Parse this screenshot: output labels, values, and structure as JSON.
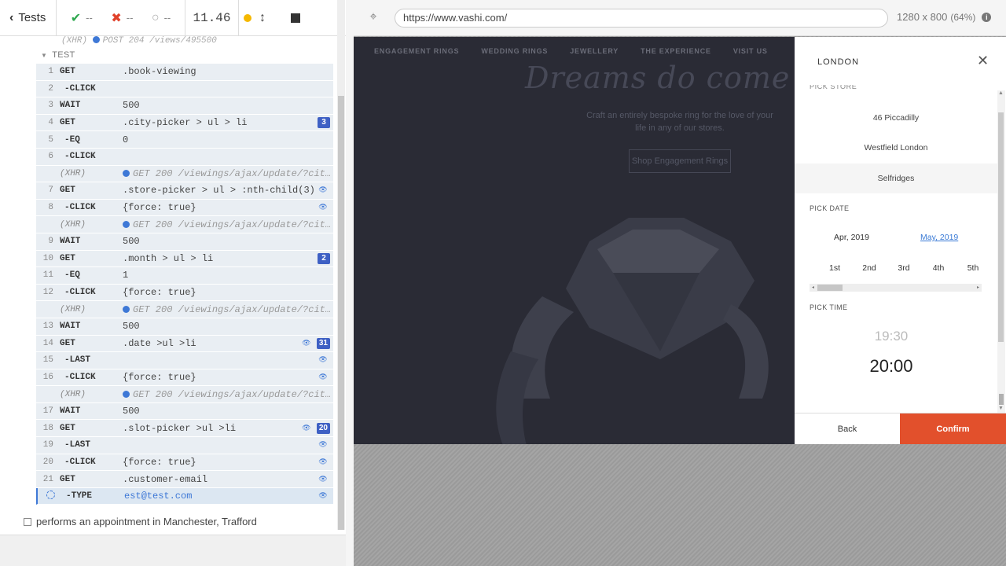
{
  "header": {
    "tests_label": "Tests",
    "passed": "--",
    "failed": "--",
    "pending": "--",
    "duration": "11.46"
  },
  "reporter": {
    "prev_command": "POST 204 /views/495500",
    "suite_label": "TEST",
    "commands": [
      {
        "num": "1",
        "name": "GET",
        "msg": ".book-viewing",
        "type": "cmd"
      },
      {
        "num": "2",
        "name": "-CLICK",
        "msg": "",
        "type": "child"
      },
      {
        "num": "3",
        "name": "WAIT",
        "msg": "500",
        "type": "cmd"
      },
      {
        "num": "4",
        "name": "GET",
        "msg": ".city-picker > ul > li",
        "type": "cmd",
        "badge": "3"
      },
      {
        "num": "5",
        "name": "-EQ",
        "msg": "0",
        "type": "child"
      },
      {
        "num": "6",
        "name": "-CLICK",
        "msg": "",
        "type": "child"
      },
      {
        "num": "",
        "name": "(XHR)",
        "msg": "GET 200 /viewings/ajax/update/?city=…",
        "type": "xhr"
      },
      {
        "num": "7",
        "name": "GET",
        "msg": ".store-picker > ul > :nth-child(3)",
        "type": "cmd",
        "eye": true
      },
      {
        "num": "8",
        "name": "-CLICK",
        "msg": "{force: true}",
        "type": "child",
        "eye": true
      },
      {
        "num": "",
        "name": "(XHR)",
        "msg": "GET 200 /viewings/ajax/update/?city=…",
        "type": "xhr"
      },
      {
        "num": "9",
        "name": "WAIT",
        "msg": "500",
        "type": "cmd"
      },
      {
        "num": "10",
        "name": "GET",
        "msg": ".month > ul > li",
        "type": "cmd",
        "badge": "2"
      },
      {
        "num": "11",
        "name": "-EQ",
        "msg": "1",
        "type": "child"
      },
      {
        "num": "12",
        "name": "-CLICK",
        "msg": "{force: true}",
        "type": "child"
      },
      {
        "num": "",
        "name": "(XHR)",
        "msg": "GET 200 /viewings/ajax/update/?city=…",
        "type": "xhr"
      },
      {
        "num": "13",
        "name": "WAIT",
        "msg": "500",
        "type": "cmd"
      },
      {
        "num": "14",
        "name": "GET",
        "msg": ".date >ul >li",
        "type": "cmd",
        "eye": true,
        "badge": "31"
      },
      {
        "num": "15",
        "name": "-LAST",
        "msg": "",
        "type": "child",
        "eye": true
      },
      {
        "num": "16",
        "name": "-CLICK",
        "msg": "{force: true}",
        "type": "child",
        "eye": true
      },
      {
        "num": "",
        "name": "(XHR)",
        "msg": "GET 200 /viewings/ajax/update/?city=…",
        "type": "xhr"
      },
      {
        "num": "17",
        "name": "WAIT",
        "msg": "500",
        "type": "cmd"
      },
      {
        "num": "18",
        "name": "GET",
        "msg": ".slot-picker >ul >li",
        "type": "cmd",
        "eye": true,
        "badge": "20"
      },
      {
        "num": "19",
        "name": "-LAST",
        "msg": "",
        "type": "child",
        "eye": true
      },
      {
        "num": "20",
        "name": "-CLICK",
        "msg": "{force: true}",
        "type": "child",
        "eye": true
      },
      {
        "num": "21",
        "name": "GET",
        "msg": ".customer-email",
        "type": "cmd",
        "eye": true
      },
      {
        "num": "",
        "name": "-TYPE",
        "msg": "est@test.com",
        "type": "active",
        "eye": true
      }
    ],
    "next_test": "performs an appointment in Manchester, Trafford"
  },
  "aut": {
    "url": "https://www.vashi.com/",
    "viewport": "1280 x 800",
    "scale": "(64%)"
  },
  "site": {
    "nav": [
      "ENGAGEMENT RINGS",
      "WEDDING RINGS",
      "JEWELLERY",
      "THE EXPERIENCE",
      "VISIT US"
    ],
    "hero_title": "Dreams do come t",
    "hero_sub": "Craft an entirely bespoke ring for the love of your life in any of our stores.",
    "hero_button": "Shop Engagement Rings"
  },
  "modal": {
    "title": "LONDON",
    "cut_label": "PICK STORE",
    "stores": [
      "46 Piccadilly",
      "Westfield London",
      "Selfridges"
    ],
    "pick_date_label": "PICK DATE",
    "months": [
      "Apr, 2019",
      "May, 2019"
    ],
    "days": [
      "1st",
      "2nd",
      "3rd",
      "4th",
      "5th"
    ],
    "pick_time_label": "PICK TIME",
    "time_prev": "19:30",
    "time_selected": "20:00",
    "back_label": "Back",
    "confirm_label": "Confirm"
  },
  "colors": {
    "accent": "#3e78d6",
    "confirm": "#e2502c",
    "site_bg": "#2a2b35"
  }
}
